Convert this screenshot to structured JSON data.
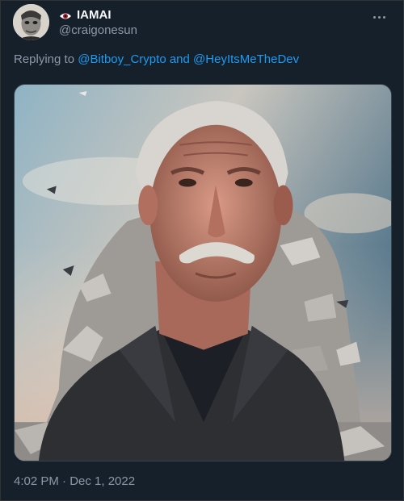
{
  "author": {
    "display_name": "IAMAI",
    "handle": "@craigonesun",
    "name_icon": "eye-icon"
  },
  "reply": {
    "prefix": "Replying to",
    "mention_1": "@Bitboy_Crypto",
    "joiner": "and",
    "mention_2": "@HeyItsMeTheDev"
  },
  "media": {
    "kind": "photo",
    "subject": "elderly man with mustache in dark jacket before heap of rubble"
  },
  "meta": {
    "timestamp": "4:02 PM · Dec 1, 2022"
  },
  "colors": {
    "background": "#15202b",
    "text_primary": "#f7f9f9",
    "text_secondary": "#8b98a5",
    "link": "#1d9bf0"
  }
}
